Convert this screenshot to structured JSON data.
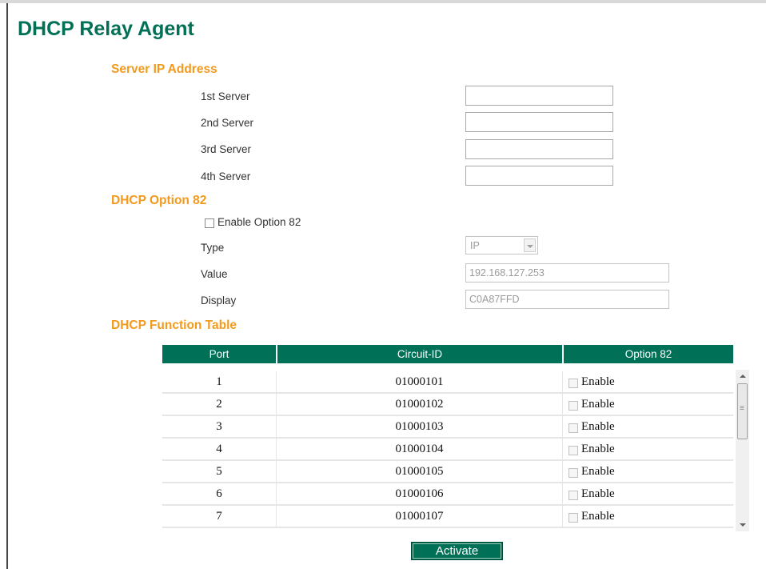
{
  "page_title": "DHCP Relay Agent",
  "server_section": {
    "title": "Server IP Address",
    "servers": [
      {
        "label": "1st Server",
        "value": ""
      },
      {
        "label": "2nd Server",
        "value": ""
      },
      {
        "label": "3rd Server",
        "value": ""
      },
      {
        "label": "4th Server",
        "value": ""
      }
    ]
  },
  "option82_section": {
    "title": "DHCP Option 82",
    "enable_label": "Enable Option 82",
    "enable_checked": false,
    "type_label": "Type",
    "type_value": "IP",
    "value_label": "Value",
    "value_value": "192.168.127.253",
    "display_label": "Display",
    "display_value": "C0A87FFD"
  },
  "function_table": {
    "title": "DHCP Function Table",
    "columns": [
      "Port",
      "Circuit-ID",
      "Option 82"
    ],
    "rows": [
      {
        "port": "1",
        "circuit_id": "01000101",
        "option82_label": "Enable"
      },
      {
        "port": "2",
        "circuit_id": "01000102",
        "option82_label": "Enable"
      },
      {
        "port": "3",
        "circuit_id": "01000103",
        "option82_label": "Enable"
      },
      {
        "port": "4",
        "circuit_id": "01000104",
        "option82_label": "Enable"
      },
      {
        "port": "5",
        "circuit_id": "01000105",
        "option82_label": "Enable"
      },
      {
        "port": "6",
        "circuit_id": "01000106",
        "option82_label": "Enable"
      },
      {
        "port": "7",
        "circuit_id": "01000107",
        "option82_label": "Enable"
      }
    ]
  },
  "activate_label": "Activate",
  "colors": {
    "title_green": "#007057",
    "section_orange": "#f39a1e",
    "header_green": "#007057"
  }
}
